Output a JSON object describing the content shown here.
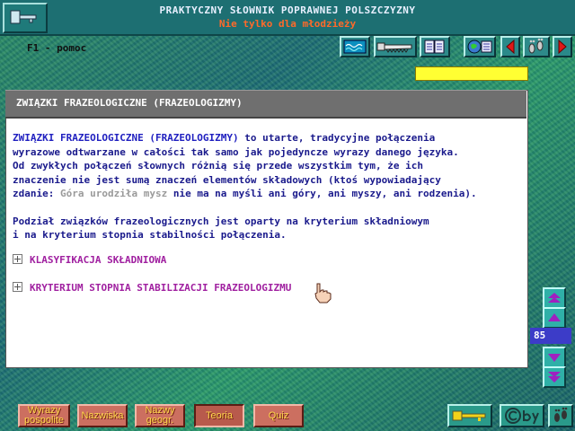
{
  "header": {
    "title": "PRAKTYCZNY SŁOWNIK POPRAWNEJ POLSZCZYZNY",
    "subtitle": "Nie tylko dla młodzieży"
  },
  "help": {
    "label": "F1 - pomoc"
  },
  "panel": {
    "heading": "ZWIĄZKI FRAZEOLOGICZNE (FRAZEOLOGIZMY)",
    "intro_term": "ZWIĄZKI FRAZEOLOGICZNE (FRAZEOLOGIZMY)",
    "intro_rest_1": " to utarte, tradycyjne połączenia",
    "line2": "wyrazowe odtwarzane w całości tak samo jak pojedyncze wyrazy danego języka.",
    "line3": "Od zwykłych połączeń słownych różnią się przede wszystkim tym, że ich",
    "line4": "znaczenie nie jest sumą znaczeń elementów składowych (ktoś wypowiadający",
    "line5_a": "zdanie: ",
    "line5_example": "Góra urodziła mysz",
    "line5_b": " nie ma na myśli ani góry, ani myszy, ani rodzenia).",
    "para2_line1": "Podział związków frazeologicznych jest oparty na  kryterium składniowym",
    "para2_line2": "i na  kryterium stopnia stabilności połączenia.",
    "expanders": [
      {
        "label": "KLASYFIKACJA SKŁADNIOWA"
      },
      {
        "label": "KRYTERIUM STOPNIA STABILIZACJI FRAZEOLOGIZMU"
      }
    ]
  },
  "page": {
    "number": "85"
  },
  "bottom_nav": [
    {
      "label_1": "Wyrazy",
      "label_2": "pospolite"
    },
    {
      "label_1": "Nazwiska",
      "label_2": ""
    },
    {
      "label_1": "Nazwy",
      "label_2": "geogr."
    },
    {
      "label_1": "Teoria",
      "label_2": ""
    },
    {
      "label_1": "Quiz",
      "label_2": ""
    }
  ],
  "colors": {
    "heading_bar": "#6f6f6f",
    "text_blue": "#1a1a8c",
    "expander_purple": "#a020a0",
    "nav_button": "#cc6f60",
    "nav_text": "#ffd84a",
    "page_badge": "#3c3cc8",
    "highlight": "#ffff33"
  },
  "icons": {
    "top_left": "key-icon",
    "toolbar": [
      "waves-icon",
      "saw-icon",
      "book-icon",
      "globe-icon",
      "back-arrow-icon",
      "footprints-icon",
      "forward-arrow-icon"
    ],
    "bottom": [
      "key-icon",
      "copyright-icon",
      "footprints-icon"
    ]
  }
}
